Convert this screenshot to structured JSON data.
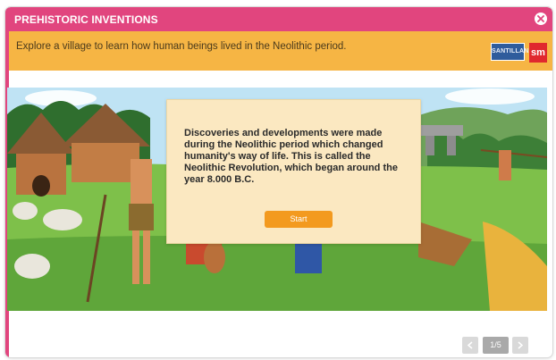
{
  "window": {
    "title": "PREHISTORIC INVENTIONS",
    "accent_color": "#e1457e",
    "close_icon": "close-icon"
  },
  "instruction_bar": {
    "text": "Explore a village to learn how human beings lived in the Neolithic period.",
    "color": "#f6b544"
  },
  "logos": {
    "publisher_a": "SANTILLANA",
    "publisher_b": "sm"
  },
  "intro_modal": {
    "text": "Discoveries and developments were made during the Neolithic period which changed humanity's way of life. This is called the Neolithic Revolution, which began around the year 8.000 B.C.",
    "start_label": "Start",
    "button_color": "#f39a1f"
  },
  "pager": {
    "current": "1/5",
    "prev_icon": "chevron-left-icon",
    "next_icon": "chevron-right-icon"
  },
  "scene": {
    "description_icon": "neolithic-village-illustration"
  }
}
